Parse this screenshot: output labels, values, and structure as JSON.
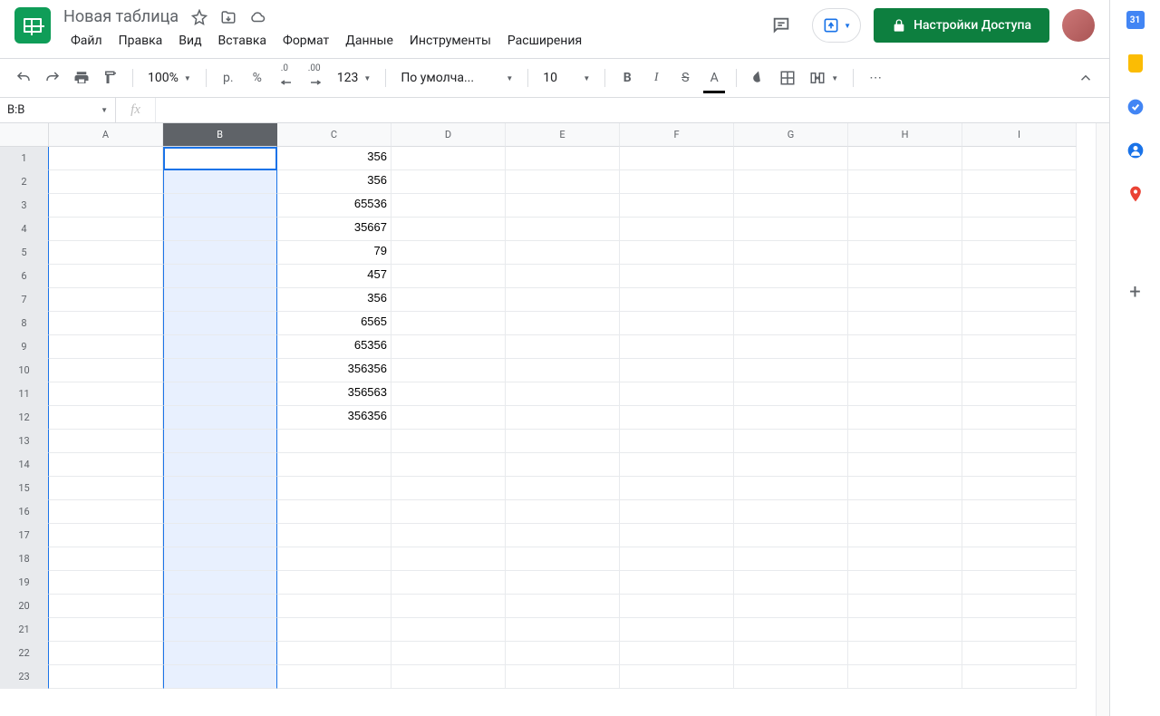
{
  "doc": {
    "title": "Новая таблица"
  },
  "menus": [
    "Файл",
    "Правка",
    "Вид",
    "Вставка",
    "Формат",
    "Данные",
    "Инструменты",
    "Расширения"
  ],
  "share": {
    "label": "Настройки Доступа"
  },
  "toolbar": {
    "zoom": "100%",
    "currency": "р.",
    "percent": "%",
    "dec_dec": ".0",
    "inc_dec": ".00",
    "numfmt": "123",
    "font": "По умолча...",
    "size": "10",
    "bold": "B",
    "italic": "I",
    "strike": "S",
    "textcolor": "A",
    "more": "⋯"
  },
  "namebox": "B:B",
  "columns": [
    "A",
    "B",
    "C",
    "D",
    "E",
    "F",
    "G",
    "H",
    "I"
  ],
  "selected_col": "B",
  "rows": 23,
  "cells": {
    "C1": "356",
    "C2": "356",
    "C3": "65536",
    "C4": "35667",
    "C5": "79",
    "C6": "457",
    "C7": "356",
    "C8": "6565",
    "C9": "65356",
    "C10": "356356",
    "C11": "356563",
    "C12": "356356"
  },
  "sidepanel": {
    "calendar": "31"
  }
}
